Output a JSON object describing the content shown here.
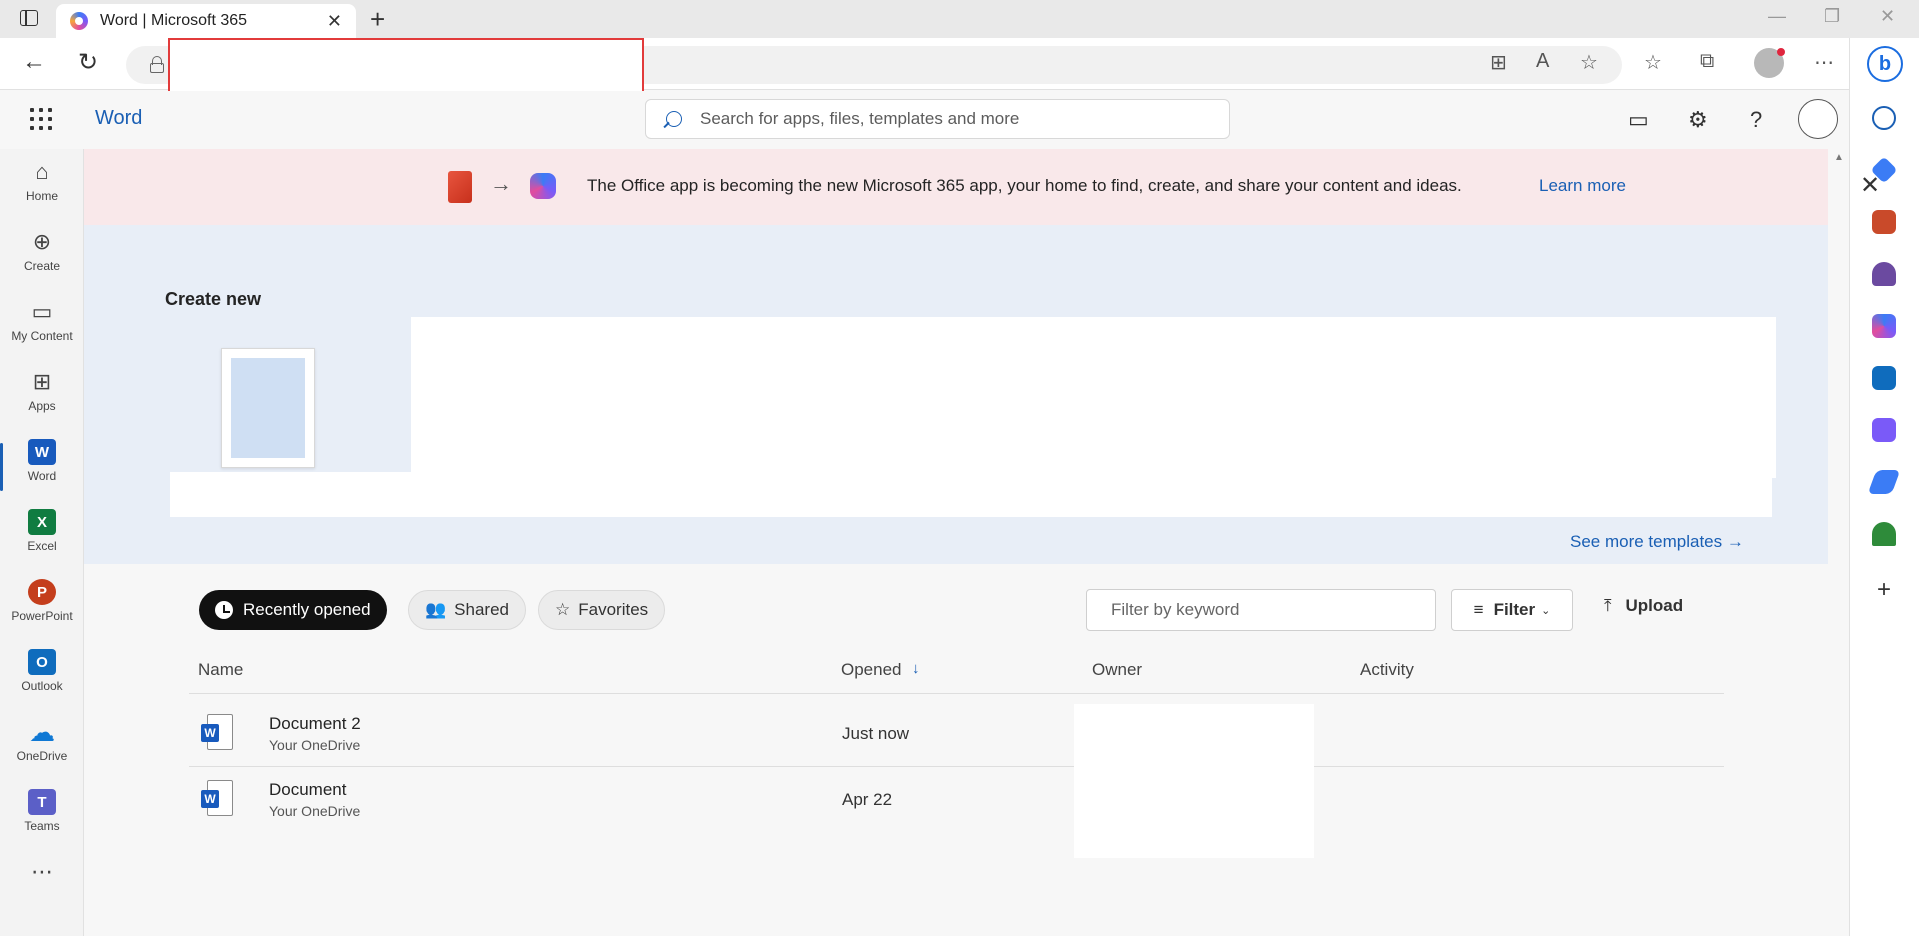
{
  "browser": {
    "tab_title": "Word | Microsoft 365",
    "tab_close": "✕",
    "new_tab": "+",
    "win_min": "—",
    "win_restore": "❐",
    "win_close": "✕",
    "back": "←",
    "reload": "↻",
    "address_value": "",
    "addr_icons": [
      "⊞",
      "A",
      "☆",
      "☆",
      "⧉",
      "⋯"
    ]
  },
  "header": {
    "app_name": "Word",
    "search_placeholder": "Search for apps, files, templates and more"
  },
  "rail": {
    "items": [
      {
        "label": "Home",
        "icon": "⌂"
      },
      {
        "label": "Create",
        "icon": "⊕"
      },
      {
        "label": "My Content",
        "icon": "▭"
      },
      {
        "label": "Apps",
        "icon": "⊞"
      },
      {
        "label": "Word",
        "tile": "W"
      },
      {
        "label": "Excel",
        "tile": "X"
      },
      {
        "label": "PowerPoint",
        "tile": "P"
      },
      {
        "label": "Outlook",
        "tile": "O"
      },
      {
        "label": "OneDrive",
        "tile": "☁"
      },
      {
        "label": "Teams",
        "tile": "T"
      }
    ],
    "more": "⋯"
  },
  "banner": {
    "message": "The Office app is becoming the new Microsoft 365 app, your home to find, create, and share your content and ideas.",
    "link": "Learn more"
  },
  "create": {
    "title": "Create new",
    "see_more": "See more templates →"
  },
  "files": {
    "tabs": [
      "Recently opened",
      "Shared",
      "Favorites"
    ],
    "filter_placeholder": "Filter by keyword",
    "filter_label": "Filter",
    "upload_label": "Upload",
    "columns": [
      "Name",
      "Opened",
      "Owner",
      "Activity"
    ],
    "rows": [
      {
        "name": "Document 2",
        "location": "Your OneDrive",
        "opened": "Just now"
      },
      {
        "name": "Document",
        "location": "Your OneDrive",
        "opened": "Apr 22"
      }
    ]
  },
  "colors": {
    "accent": "#1a5fb4",
    "banner_bg": "#f9e8ea",
    "create_bg": "#e8eef7",
    "word": "#185abd",
    "excel": "#107c41",
    "powerpoint": "#c43e1c",
    "outlook": "#0f6cbd",
    "onedrive": "#0f78d4",
    "teams": "#5b5fc7",
    "highlight_box": "#e23b3b"
  }
}
